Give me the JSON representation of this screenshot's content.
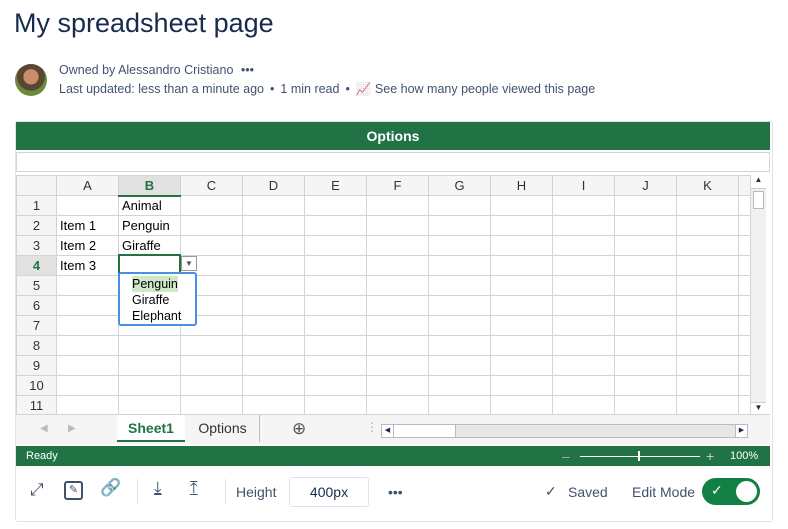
{
  "page": {
    "title": "My spreadsheet page",
    "owner": "Owned by Alessandro Cristiano",
    "more": "•••",
    "updated": "Last updated: less than a minute ago",
    "read": "1 min read",
    "views": "See how many people viewed this page",
    "sep": "•"
  },
  "sheet": {
    "title": "Options",
    "columns": [
      "A",
      "B",
      "C",
      "D",
      "E",
      "F",
      "G",
      "H",
      "I",
      "J",
      "K"
    ],
    "rows": [
      [
        "1",
        "",
        "Animal"
      ],
      [
        "2",
        "Item 1",
        "Penguin"
      ],
      [
        "3",
        "Item 2",
        "Giraffe"
      ],
      [
        "4",
        "Item 3",
        ""
      ],
      [
        "5",
        "",
        ""
      ],
      [
        "6",
        "",
        ""
      ],
      [
        "7",
        "",
        ""
      ],
      [
        "8",
        "",
        ""
      ],
      [
        "9",
        "",
        ""
      ],
      [
        "10",
        "",
        ""
      ],
      [
        "11",
        "",
        ""
      ]
    ],
    "dropdown": [
      "Penguin",
      "Giraffe",
      "Elephant"
    ],
    "tabs": [
      "Sheet1",
      "Options"
    ],
    "status": "Ready",
    "zoom": "100%"
  },
  "toolbar": {
    "height_label": "Height",
    "height_value": "400px",
    "more": "•••",
    "saved": "Saved",
    "edit_mode": "Edit Mode",
    "edit_on": true
  }
}
